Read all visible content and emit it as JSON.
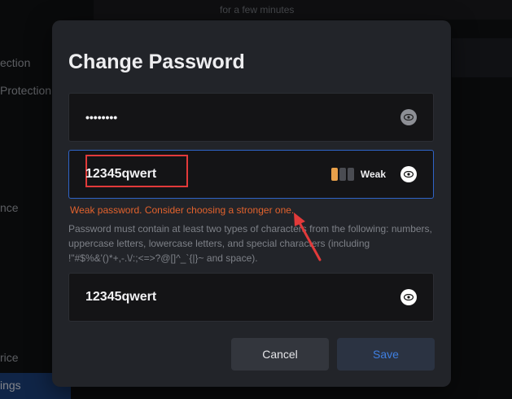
{
  "background": {
    "top_text": "for a few minutes",
    "sidebar_items": [
      "ection",
      "Protection",
      "nce",
      "rice",
      "ings"
    ]
  },
  "dialog": {
    "title": "Change Password",
    "current_password": {
      "value": "••••••••"
    },
    "new_password": {
      "value": "12345qwert",
      "strength_label": "Weak"
    },
    "error": "Weak password. Consider choosing a stronger one.",
    "hint": "Password must contain at least two types of characters from the following: numbers, uppercase letters, lowercase letters, and special characters (including !\"#$%&'()*+,-.\\/:;<=>?@[]^_`{|}~ and space).",
    "confirm_password": {
      "value": "12345qwert"
    },
    "cancel_label": "Cancel",
    "save_label": "Save"
  },
  "colors": {
    "accent": "#2f64c8",
    "error": "#e2622d",
    "annotation": "#e23a3a",
    "strength_weak": "#e8a04a"
  }
}
